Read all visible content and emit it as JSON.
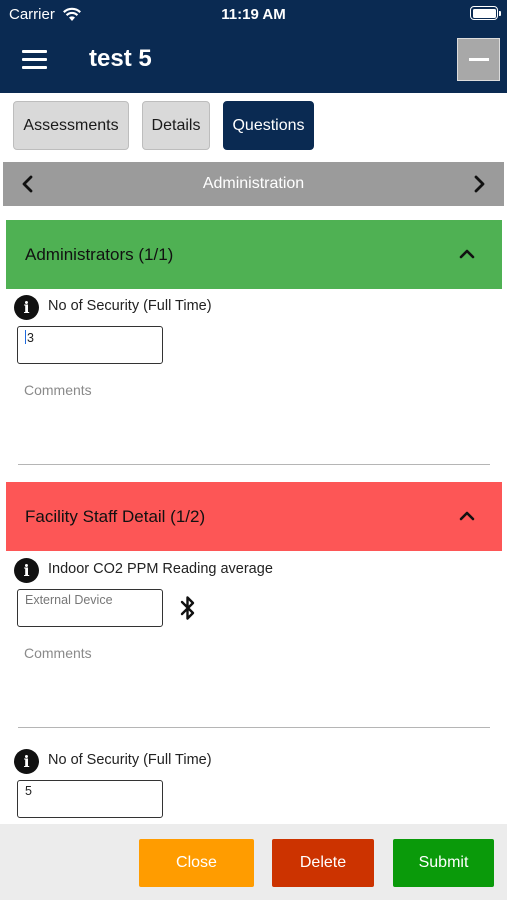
{
  "status_bar": {
    "carrier": "Carrier",
    "time": "11:19 AM"
  },
  "header": {
    "title": "test 5",
    "menu_icon": "hamburger-icon",
    "collapse_icon": "minus-icon"
  },
  "tabs": [
    {
      "label": "Assessments",
      "active": false
    },
    {
      "label": "Details",
      "active": false
    },
    {
      "label": "Questions",
      "active": true
    }
  ],
  "section": {
    "label": "Administration",
    "prev_icon": "chevron-left-icon",
    "next_icon": "chevron-right-icon"
  },
  "groups": [
    {
      "title": "Administrators (1/1)",
      "color": "#4fb153",
      "expanded": true,
      "questions": [
        {
          "text": "No of Security (Full Time)",
          "value": "3",
          "comments_placeholder": "Comments"
        }
      ]
    },
    {
      "title": "Facility Staff Detail (1/2)",
      "color": "#fd5656",
      "expanded": true,
      "questions": [
        {
          "text": "Indoor CO2 PPM Reading average",
          "placeholder": "External Device",
          "comments_placeholder": "Comments",
          "icon": "bluetooth-icon"
        },
        {
          "text": "No of Security (Full Time)",
          "value": "5"
        }
      ]
    }
  ],
  "actions": {
    "close": {
      "label": "Close",
      "color": "#ff9c00"
    },
    "delete": {
      "label": "Delete",
      "color": "#cc3300"
    },
    "submit": {
      "label": "Submit",
      "color": "#0a9a0a"
    }
  }
}
